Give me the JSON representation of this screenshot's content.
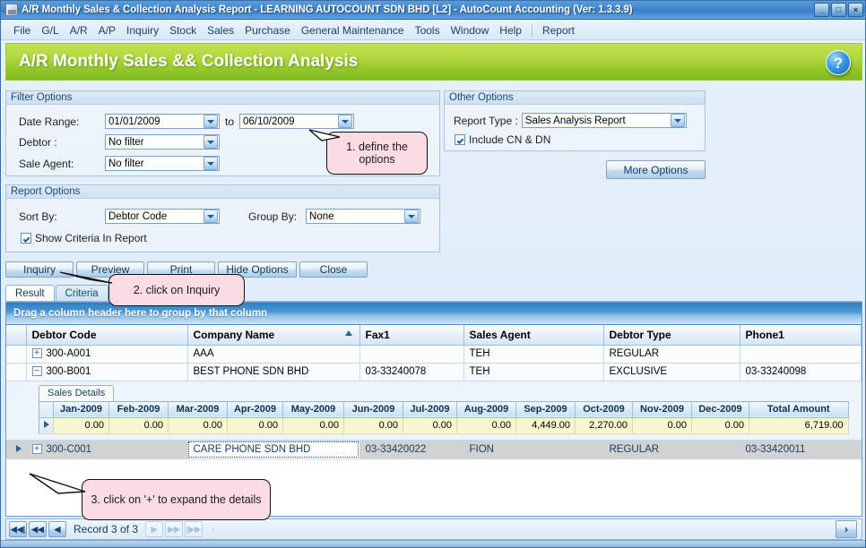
{
  "window": {
    "title": "A/R Monthly Sales & Collection Analysis Report - LEARNING AUTOCOUNT SDN BHD [L2] - AutoCount Accounting (Ver: 1.3.3.9)",
    "minimize_label": "_",
    "maximize_label": "□",
    "close_label": "×"
  },
  "menu": {
    "items": [
      {
        "label": "File"
      },
      {
        "label": "G/L"
      },
      {
        "label": "A/R"
      },
      {
        "label": "A/P"
      },
      {
        "label": "Inquiry"
      },
      {
        "label": "Stock"
      },
      {
        "label": "Sales"
      },
      {
        "label": "Purchase"
      },
      {
        "label": "General Maintenance"
      },
      {
        "label": "Tools"
      },
      {
        "label": "Window"
      },
      {
        "label": "Help"
      },
      {
        "label": "Report"
      }
    ]
  },
  "banner": {
    "title": "A/R Monthly Sales && Collection Analysis",
    "help_label": "?"
  },
  "filter_options": {
    "caption": "Filter Options",
    "date_range_label": "Date Range:",
    "date_from": "01/01/2009",
    "date_to_label": "to",
    "date_to": "06/10/2009",
    "debtor_label": "Debtor :",
    "debtor_value": "No filter",
    "sale_agent_label": "Sale Agent:",
    "sale_agent_value": "No filter"
  },
  "other_options": {
    "caption": "Other Options",
    "report_type_label": "Report Type :",
    "report_type_value": "Sales Analysis Report",
    "include_cn_dn_label": "Include CN & DN",
    "include_cn_dn_checked": true,
    "more_options_label": "More Options"
  },
  "report_options": {
    "caption": "Report Options",
    "sort_by_label": "Sort By:",
    "sort_by_value": "Debtor Code",
    "group_by_label": "Group By:",
    "group_by_value": "None",
    "show_criteria_label": "Show Criteria In Report",
    "show_criteria_checked": true
  },
  "action_buttons": [
    {
      "label": "Inquiry"
    },
    {
      "label": "Preview"
    },
    {
      "label": "Print"
    },
    {
      "label": "Hide Options"
    },
    {
      "label": "Close"
    }
  ],
  "tabs": [
    {
      "label": "Result",
      "active": true
    },
    {
      "label": "Criteria",
      "active": false
    }
  ],
  "grid": {
    "group_hint": "Drag a column header here to group by that column",
    "columns": [
      {
        "label": "Debtor Code",
        "sorted": false
      },
      {
        "label": "Company Name",
        "sorted": true,
        "sort_dir": "asc"
      },
      {
        "label": "Fax1",
        "sorted": false
      },
      {
        "label": "Sales Agent",
        "sorted": false
      },
      {
        "label": "Debtor Type",
        "sorted": false
      },
      {
        "label": "Phone1",
        "sorted": false
      }
    ],
    "rows": [
      {
        "expander": "+",
        "expanded": false,
        "selected": false,
        "cells": [
          "300-A001",
          "AAA",
          "",
          "TEH",
          "REGULAR",
          ""
        ]
      },
      {
        "expander": "−",
        "expanded": true,
        "selected": false,
        "cells": [
          "300-B001",
          "BEST PHONE SDN BHD",
          "03-33240078",
          "TEH",
          "EXCLUSIVE",
          "03-33240098"
        ]
      },
      {
        "expander": "+",
        "expanded": false,
        "selected": true,
        "cells": [
          "300-C001",
          "CARE PHONE SDN BHD",
          "03-33420022",
          "FION",
          "REGULAR",
          "03-33420011"
        ]
      }
    ],
    "detail": {
      "tab_label": "Sales Details",
      "columns": [
        "Jan-2009",
        "Feb-2009",
        "Mar-2009",
        "Apr-2009",
        "May-2009",
        "Jun-2009",
        "Jul-2009",
        "Aug-2009",
        "Sep-2009",
        "Oct-2009",
        "Nov-2009",
        "Dec-2009",
        "Total Amount"
      ],
      "rows": [
        [
          "0.00",
          "0.00",
          "0.00",
          "0.00",
          "0.00",
          "0.00",
          "0.00",
          "0.00",
          "4,449.00",
          "2,270.00",
          "0.00",
          "0.00",
          "6,719.00"
        ]
      ]
    }
  },
  "callouts": [
    {
      "text": "1. define the options"
    },
    {
      "text": "2. click on Inquiry"
    },
    {
      "text": "3. click on '+' to expand the details"
    }
  ],
  "navbar": {
    "first_label": "◀◀|",
    "prev_page_label": "◀◀",
    "prev_label": "◀",
    "record_text": "Record 3 of 3",
    "next_label": "▶",
    "next_page_label": "▶▶",
    "last_label": "|▶▶",
    "cancel_label": "‹",
    "expand_right_label": "›"
  },
  "colors": {
    "title_blue": "#3e86cd",
    "banner_green": "#a8d334",
    "callout_pink": "#fcdce4",
    "detail_yellow": "#f6f6cf",
    "selected_gray": "#d2d2d2"
  }
}
